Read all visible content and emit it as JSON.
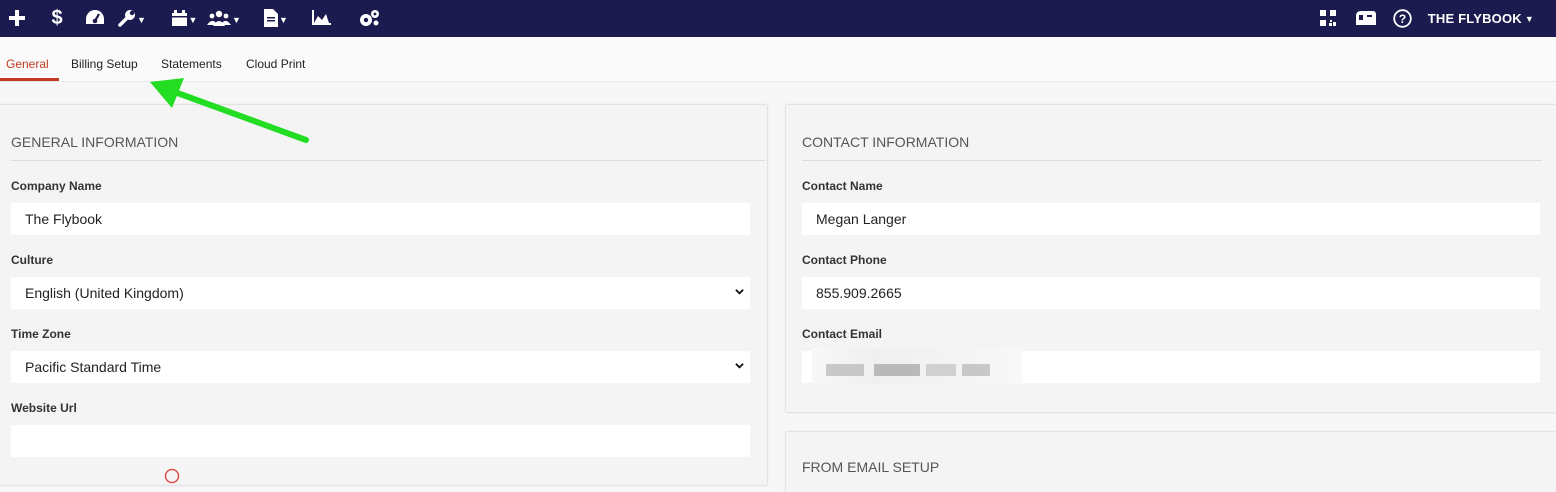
{
  "navbar": {
    "icons": [
      {
        "name": "add-icon",
        "glyph": "+"
      },
      {
        "name": "dollar-icon",
        "glyph": "$"
      },
      {
        "name": "dashboard-gauge-icon"
      },
      {
        "name": "wrench-icon"
      },
      {
        "name": "calendar-icon"
      },
      {
        "name": "people-icon"
      },
      {
        "name": "document-icon"
      },
      {
        "name": "area-chart-icon"
      },
      {
        "name": "settings-cogs-icon"
      }
    ],
    "right_icons": [
      {
        "name": "qr-code-icon"
      },
      {
        "name": "mailbox-icon"
      },
      {
        "name": "help-icon",
        "glyph": "?"
      }
    ],
    "account_name": "THE FLYBOOK"
  },
  "tabs": [
    {
      "label": "General",
      "active": true
    },
    {
      "label": "Billing Setup",
      "active": false
    },
    {
      "label": "Statements",
      "active": false
    },
    {
      "label": "Cloud Print",
      "active": false
    }
  ],
  "general_info": {
    "title": "GENERAL INFORMATION",
    "company_name": {
      "label": "Company Name",
      "value": "The Flybook"
    },
    "culture": {
      "label": "Culture",
      "value": "English (United Kingdom)"
    },
    "time_zone": {
      "label": "Time Zone",
      "value": "Pacific Standard Time"
    },
    "website_url": {
      "label": "Website Url",
      "value": ""
    }
  },
  "contact_info": {
    "title": "CONTACT INFORMATION",
    "contact_name": {
      "label": "Contact Name",
      "value": "Megan Langer"
    },
    "contact_phone": {
      "label": "Contact Phone",
      "value": "855.909.2665"
    },
    "contact_email": {
      "label": "Contact Email",
      "value": ""
    }
  },
  "from_email": {
    "title": "FROM EMAIL SETUP"
  },
  "colors": {
    "navbar": "#1c1b4f",
    "active_tab": "#c23b22",
    "annotation_arrow": "#22dd22"
  }
}
